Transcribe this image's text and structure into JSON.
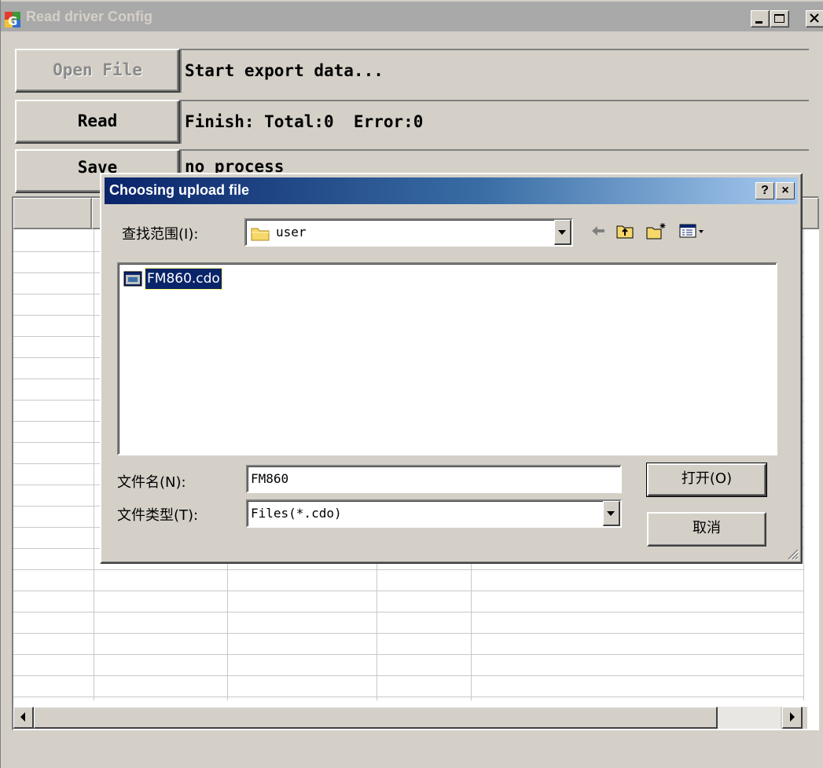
{
  "window": {
    "title": "Read driver Config",
    "buttons": {
      "open_file": "Open File",
      "read": "Read",
      "save": "Save"
    },
    "status": {
      "line1": "Start export data...",
      "line2": "Finish: Total:0  Error:0",
      "line3": "no process"
    }
  },
  "dialog": {
    "title": "Choosing upload file",
    "help_button": "?",
    "close_button": "×",
    "look_in_label": "查找范围(I):",
    "look_in_value": "user",
    "files": [
      {
        "name": "FM860.cdo",
        "selected": true
      }
    ],
    "filename_label": "文件名(N):",
    "filename_value": "FM860",
    "filetype_label": "文件类型(T):",
    "filetype_value": "Files(*.cdo)",
    "open_button": "打开(O)",
    "cancel_button": "取消"
  },
  "icons": [
    "app-icon",
    "folder-icon",
    "back-arrow-icon",
    "up-folder-icon",
    "new-folder-icon",
    "view-menu-icon",
    "file-icon",
    "size-grip-icon"
  ],
  "colors": {
    "dialog_title_start": "#0a246a",
    "dialog_title_end": "#a6caf0",
    "selection": "#0a246a",
    "face": "#d4d0c8"
  }
}
